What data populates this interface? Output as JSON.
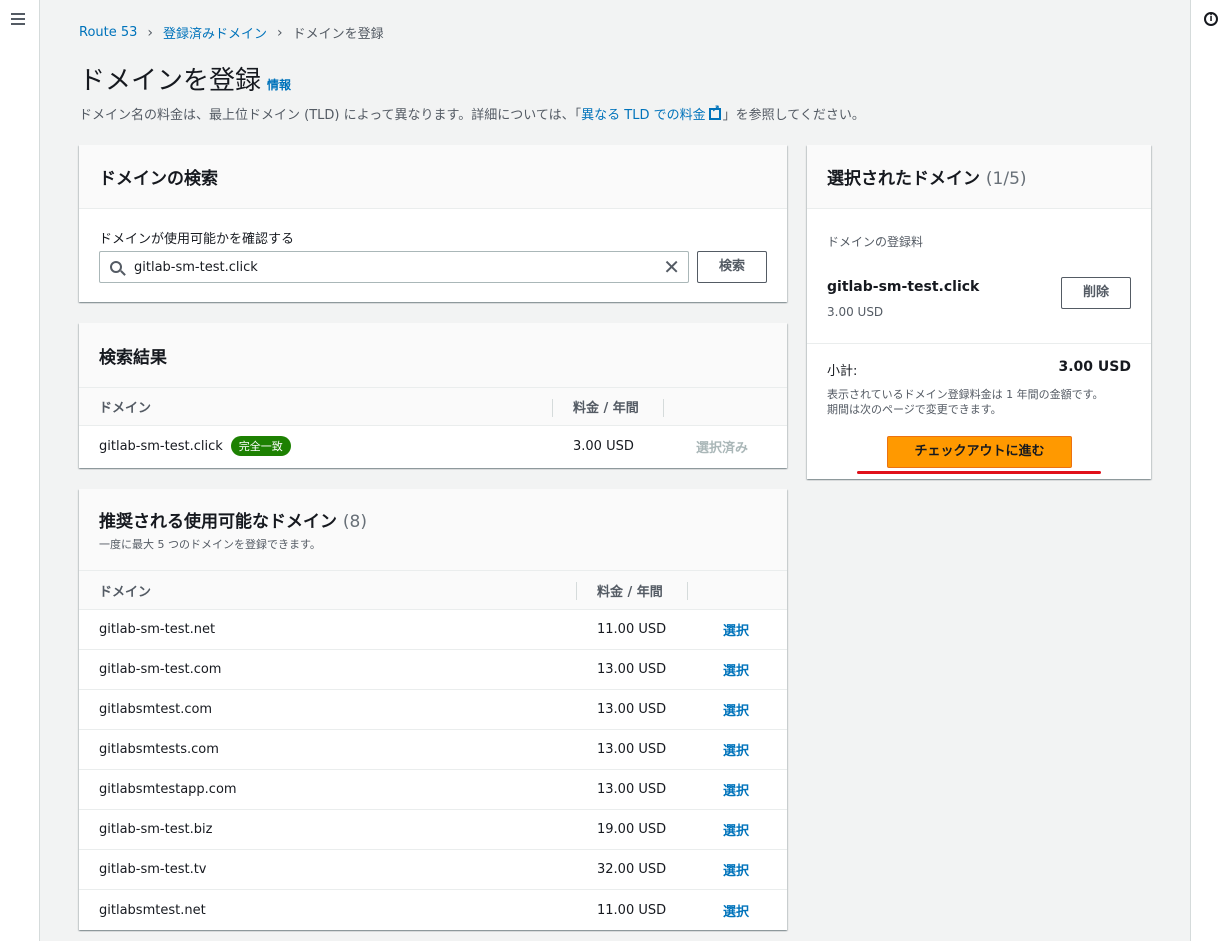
{
  "breadcrumb": {
    "items": [
      "Route 53",
      "登録済みドメイン"
    ],
    "current": "ドメインを登録"
  },
  "page": {
    "title": "ドメインを登録",
    "info_link": "情報",
    "desc_before": "ドメイン名の料金は、最上位ドメイン (TLD) によって異なります。詳細については、「",
    "desc_link": "異なる TLD での料金",
    "desc_after": "」を参照してください。"
  },
  "search_panel": {
    "title": "ドメインの検索",
    "label": "ドメインが使用可能かを確認する",
    "value": "gitlab-sm-test.click",
    "button": "検索"
  },
  "results_panel": {
    "title": "検索結果",
    "col_domain": "ドメイン",
    "col_price": "料金 / 年間",
    "row": {
      "domain": "gitlab-sm-test.click",
      "badge": "完全一致",
      "price": "3.00 USD",
      "action": "選択済み"
    }
  },
  "suggested_panel": {
    "title": "推奨される使用可能なドメイン",
    "count": "(8)",
    "subtitle": "一度に最大 5 つのドメインを登録できます。",
    "col_domain": "ドメイン",
    "col_price": "料金 / 年間",
    "rows": [
      {
        "domain": "gitlab-sm-test.net",
        "price": "11.00 USD",
        "action": "選択"
      },
      {
        "domain": "gitlab-sm-test.com",
        "price": "13.00 USD",
        "action": "選択"
      },
      {
        "domain": "gitlabsmtest.com",
        "price": "13.00 USD",
        "action": "選択"
      },
      {
        "domain": "gitlabsmtests.com",
        "price": "13.00 USD",
        "action": "選択"
      },
      {
        "domain": "gitlabsmtestapp.com",
        "price": "13.00 USD",
        "action": "選択"
      },
      {
        "domain": "gitlab-sm-test.biz",
        "price": "19.00 USD",
        "action": "選択"
      },
      {
        "domain": "gitlab-sm-test.tv",
        "price": "32.00 USD",
        "action": "選択"
      },
      {
        "domain": "gitlabsmtest.net",
        "price": "11.00 USD",
        "action": "選択"
      }
    ]
  },
  "selected_panel": {
    "title": "選択されたドメイン",
    "count": "(1/5)",
    "fee_label": "ドメインの登録料",
    "domain": "gitlab-sm-test.click",
    "domain_price": "3.00 USD",
    "delete_button": "削除",
    "subtotal_label": "小計:",
    "subtotal_value": "3.00 USD",
    "note_line1": "表示されているドメイン登録料金は 1 年間の金額です。",
    "note_line2": "期間は次のページで変更できます。",
    "checkout_button": "チェックアウトに進む"
  },
  "colors": {
    "accent": "#0073bb",
    "primary_button": "#ff9900",
    "badge": "#1d8102",
    "highlight": "#e0101a"
  }
}
